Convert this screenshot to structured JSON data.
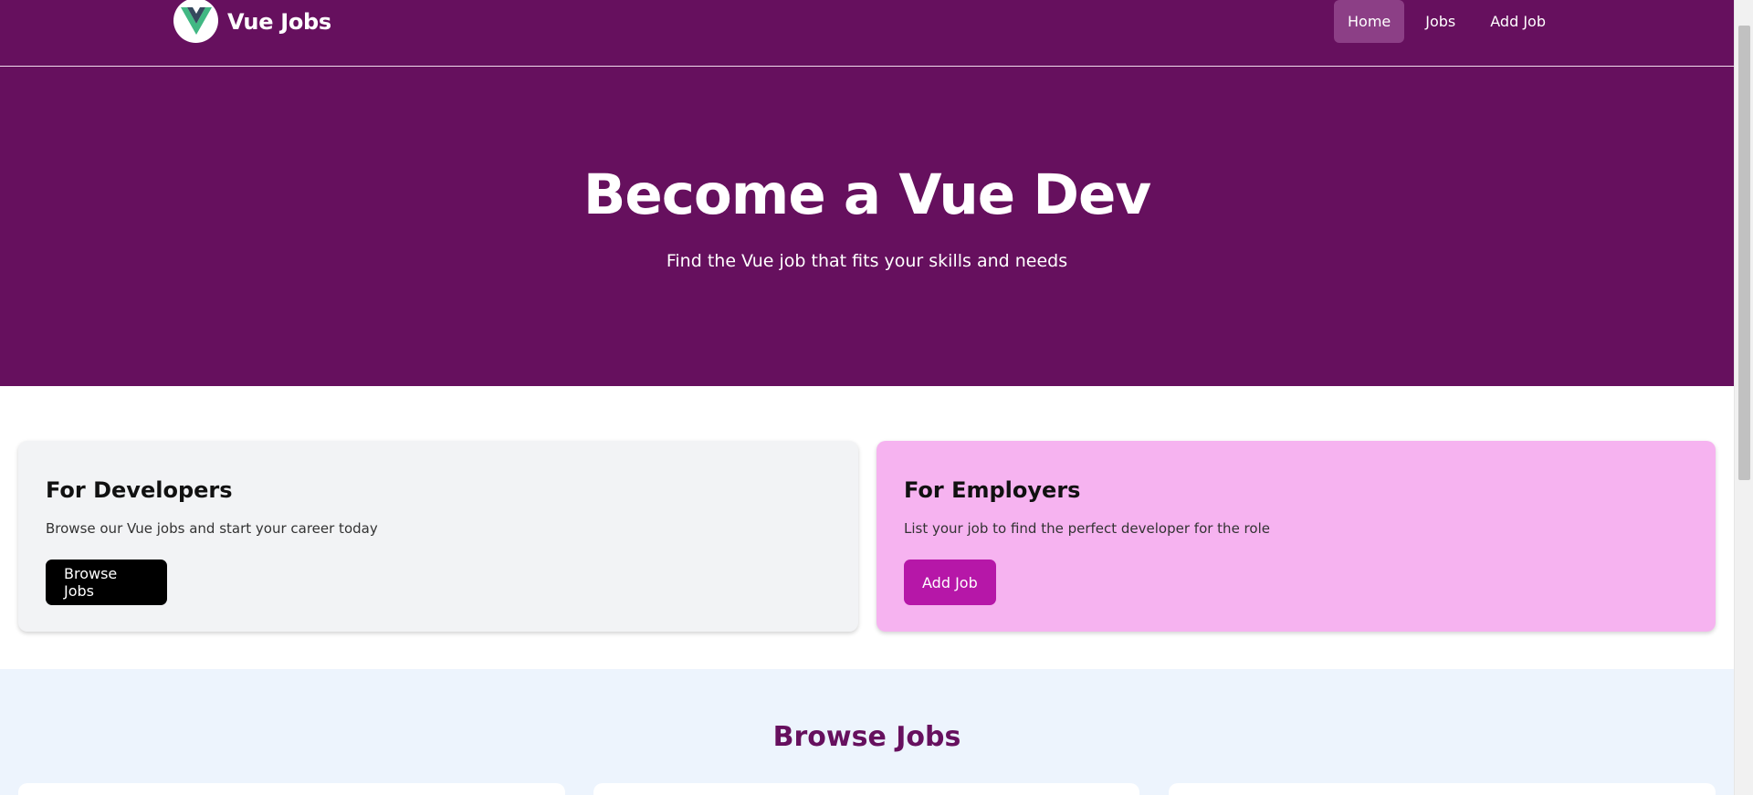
{
  "navbar": {
    "brand": "Vue Jobs",
    "logo_icon": "vue-logo-icon",
    "links": [
      {
        "label": "Home",
        "active": true
      },
      {
        "label": "Jobs",
        "active": false
      },
      {
        "label": "Add Job",
        "active": false
      }
    ]
  },
  "hero": {
    "title": "Become a Vue Dev",
    "subtitle": "Find the Vue job that fits your skills and needs"
  },
  "cards": {
    "developers": {
      "title": "For Developers",
      "text": "Browse our Vue jobs and start your career today",
      "button": "Browse Jobs"
    },
    "employers": {
      "title": "For Employers",
      "text": "List your job to find the perfect developer for the role",
      "button": "Add Job"
    }
  },
  "browse": {
    "title": "Browse Jobs"
  },
  "colors": {
    "primary": "#66105e",
    "nav_active": "#8c3f86",
    "developer_card": "#f2f3f5",
    "employer_card": "#f6b3f0",
    "employer_button": "#b617a8",
    "browse_bg": "#edf4fd"
  }
}
